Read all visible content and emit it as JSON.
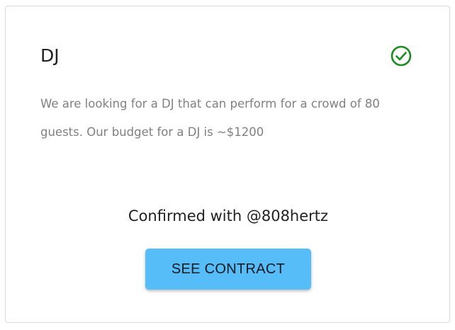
{
  "card": {
    "title": "DJ",
    "status_icon": "check-circle-icon",
    "status_color": "#1a8c1f",
    "description": "We are looking for a DJ that can perform for a crowd of 80 guests. Our budget for a DJ is ~$1200",
    "confirmed_text": "Confirmed with @808hertz",
    "button_label": "SEE CONTRACT",
    "button_color": "#56bdf8"
  }
}
